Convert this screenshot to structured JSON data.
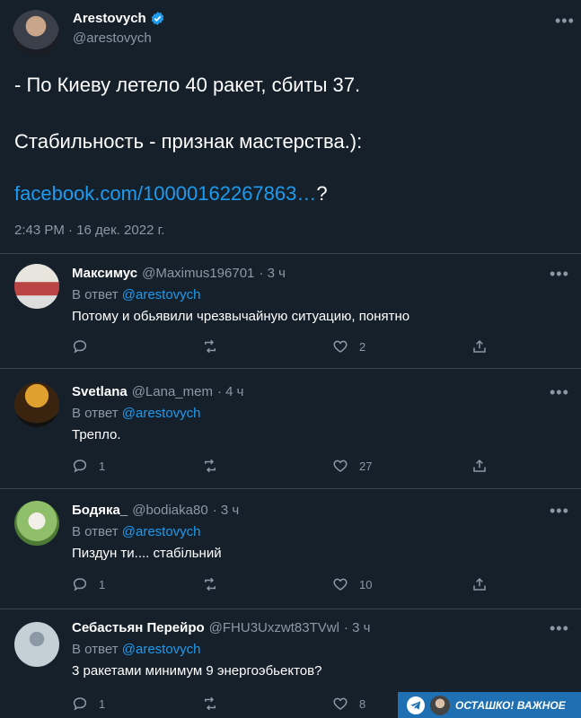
{
  "main": {
    "name": "Arestovych",
    "handle": "@arestovych",
    "line1": "- По Киеву летело 40 ракет, сбиты 37.",
    "line2": "Стабильность - признак мастерства.):",
    "link": "facebook.com/10000162267863…",
    "link_suffix": "?",
    "timestamp": "2:43 PM · 16 дек. 2022 г.",
    "more": "•••"
  },
  "in_reply_label": "В ответ",
  "replies": [
    {
      "name": "Максимус",
      "handle": "@Maximus196701",
      "time": "· 3 ч",
      "reply_to": "@arestovych",
      "text": "Потому и обьявили чрезвычайную ситуацию, понятно",
      "replies_count": "",
      "retweets_count": "",
      "likes_count": "2"
    },
    {
      "name": "Svetlana",
      "handle": "@Lana_mem",
      "time": "· 4 ч",
      "reply_to": "@arestovych",
      "text": "Трепло.",
      "replies_count": "1",
      "retweets_count": "",
      "likes_count": "27"
    },
    {
      "name": "Бодяка_",
      "handle": "@bodiaka80",
      "time": "· 3 ч",
      "reply_to": "@arestovych",
      "text": "Пиздун ти.... стабільний",
      "replies_count": "1",
      "retweets_count": "",
      "likes_count": "10"
    },
    {
      "name": "Себастьян Перейро",
      "handle": "@FHU3Uxzwt83TVwl",
      "time": "· 3 ч",
      "reply_to": "@arestovych",
      "text": "3 ракетами минимум 9 энергоэбьектов?",
      "replies_count": "1",
      "retweets_count": "",
      "likes_count": "8"
    }
  ],
  "badge": {
    "label": "ОСТАШКО! ВАЖНОЕ"
  },
  "colors": {
    "background": "#15202b",
    "accent": "#1d9bf0",
    "muted": "#8b98a5",
    "divider": "#38444d",
    "badge": "#1f6fb3"
  }
}
